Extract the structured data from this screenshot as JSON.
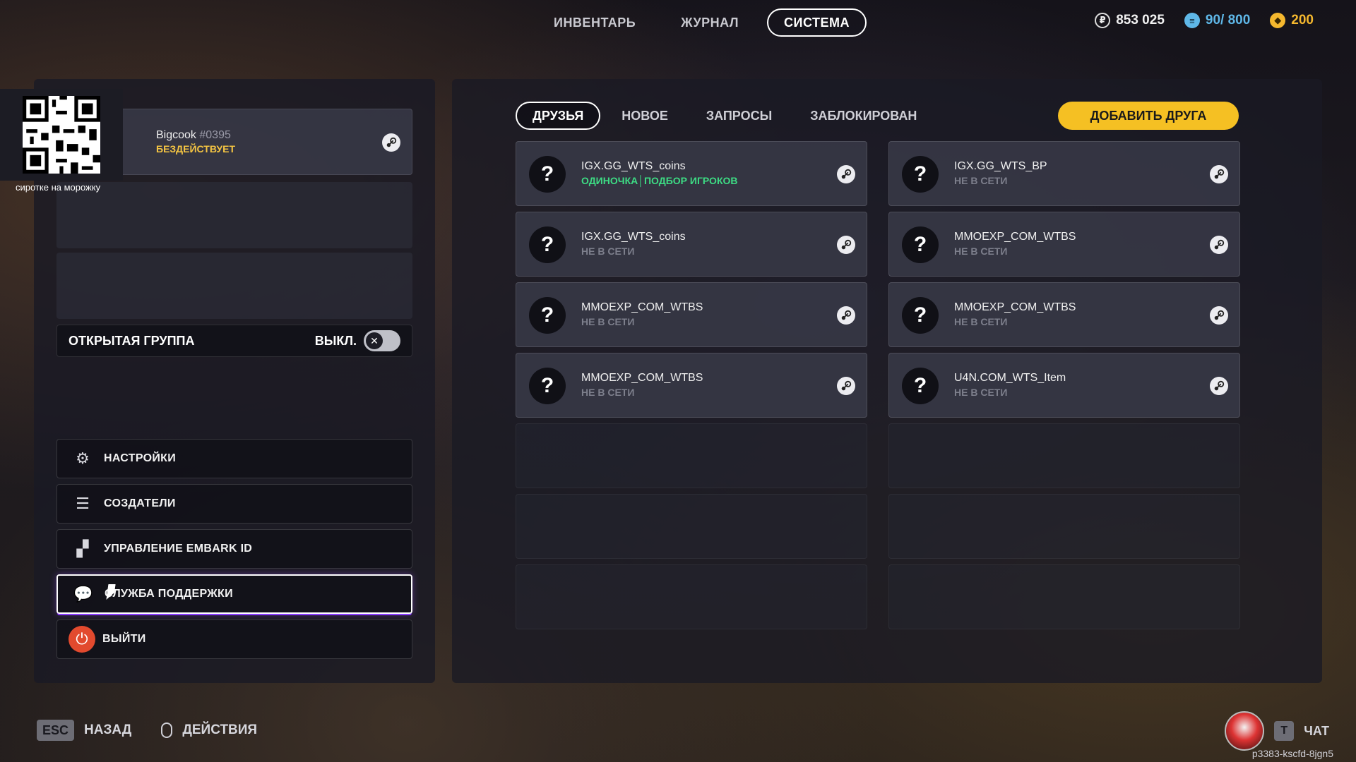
{
  "top_nav": {
    "tabs": [
      {
        "label": "ИНВЕНТАРЬ",
        "active": false
      },
      {
        "label": "ЖУРНАЛ",
        "active": false
      },
      {
        "label": "СИСТЕМА",
        "active": true
      }
    ]
  },
  "currencies": {
    "money": {
      "value": "853 025",
      "icon": "coin-icon"
    },
    "storage": {
      "value": "90/ 800",
      "icon": "storage-icon"
    },
    "tokens": {
      "value": "200",
      "icon": "tokens-icon"
    }
  },
  "colors": {
    "accent_yellow": "#f5c023",
    "online_green": "#3ddc84",
    "status_yellow": "#f5c542",
    "storage_blue": "#5fb8e8"
  },
  "profile": {
    "name": "Bigcook",
    "tag": "#0395",
    "status": "БЕЗДЕЙСТВУЕТ"
  },
  "open_group": {
    "label": "ОТКРЫТАЯ ГРУППА",
    "state": "ВЫКЛ."
  },
  "menu": {
    "settings": "НАСТРОЙКИ",
    "credits": "СОЗДАТЕЛИ",
    "embark_id": "УПРАВЛЕНИЕ EMBARK ID",
    "support": "СЛУЖБА ПОДДЕРЖКИ",
    "exit": "ВЫЙТИ"
  },
  "friends_tabs": [
    {
      "label": "ДРУЗЬЯ",
      "active": true
    },
    {
      "label": "НОВОЕ",
      "active": false
    },
    {
      "label": "ЗАПРОСЫ",
      "active": false
    },
    {
      "label": "ЗАБЛОКИРОВАН",
      "active": false
    }
  ],
  "add_friend_label": "ДОБАВИТЬ ДРУГА",
  "friends": [
    {
      "name": "IGX.GG_WTS_coins",
      "status": "ОДИНОЧКА│ПОДБОР ИГРОКОВ",
      "online": true
    },
    {
      "name": "IGX.GG_WTS_BP",
      "status": "НЕ В СЕТИ",
      "online": false
    },
    {
      "name": "IGX.GG_WTS_coins",
      "status": "НЕ В СЕТИ",
      "online": false
    },
    {
      "name": "MMOEXP_COM_WTBS",
      "status": "НЕ В СЕТИ",
      "online": false
    },
    {
      "name": "MMOEXP_COM_WTBS",
      "status": "НЕ В СЕТИ",
      "online": false
    },
    {
      "name": "MMOEXP_COM_WTBS",
      "status": "НЕ В СЕТИ",
      "online": false
    },
    {
      "name": "MMOEXP_COM_WTBS",
      "status": "НЕ В СЕТИ",
      "online": false
    },
    {
      "name": "U4N.COM_WTS_Item",
      "status": "НЕ В СЕТИ",
      "online": false
    }
  ],
  "avatar_placeholder": "?",
  "qr_caption": "сиротке на морожку",
  "bottom": {
    "esc_key": "ESC",
    "back_label": "НАЗАД",
    "actions_label": "ДЕЙСТВИЯ",
    "chat_key": "T",
    "chat_label": "ЧАТ",
    "session_id": "p3383-kscfd-8jgn5"
  }
}
